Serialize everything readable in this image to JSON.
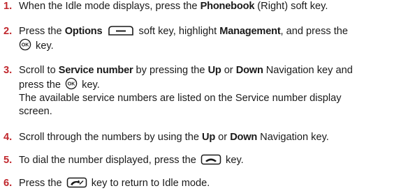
{
  "steps": [
    {
      "number": "1.",
      "line1_a": "When the Idle mode displays, press the ",
      "line1_b": "Phonebook",
      "line1_c": " (Right) soft key."
    },
    {
      "number": "2.",
      "line1_a": "Press the ",
      "line1_b": "Options",
      "line1_c": " soft key, highlight ",
      "line1_d": "Management",
      "line1_e": ", and press the",
      "line2_a": " key.",
      "icon_options": "options-soft-key-icon",
      "icon_ok": "ok-key-icon"
    },
    {
      "number": "3.",
      "line1_a": "Scroll to ",
      "line1_b": "Service number",
      "line1_c": " by pressing the ",
      "line1_d": "Up",
      "line1_e": " or ",
      "line1_f": "Down",
      "line1_g": " Navigation key and",
      "line2_a": "press the ",
      "line2_b": " key.",
      "line3": "The available service numbers are listed on the Service number display",
      "line4": "screen.",
      "icon_ok": "ok-key-icon"
    },
    {
      "number": "4.",
      "line1_a": "Scroll through the numbers by using the ",
      "line1_b": "Up",
      "line1_c": " or ",
      "line1_d": "Down",
      "line1_e": " Navigation key."
    },
    {
      "number": "5.",
      "line1_a": "To dial the number displayed, press the ",
      "line1_b": " key.",
      "icon_send": "send-key-icon"
    },
    {
      "number": "6.",
      "line1_a": "Press the ",
      "line1_b": " key to return to Idle mode.",
      "icon_end": "end-key-icon"
    }
  ],
  "colors": {
    "step_number": "#c0272d",
    "text": "#1a1a1a"
  }
}
